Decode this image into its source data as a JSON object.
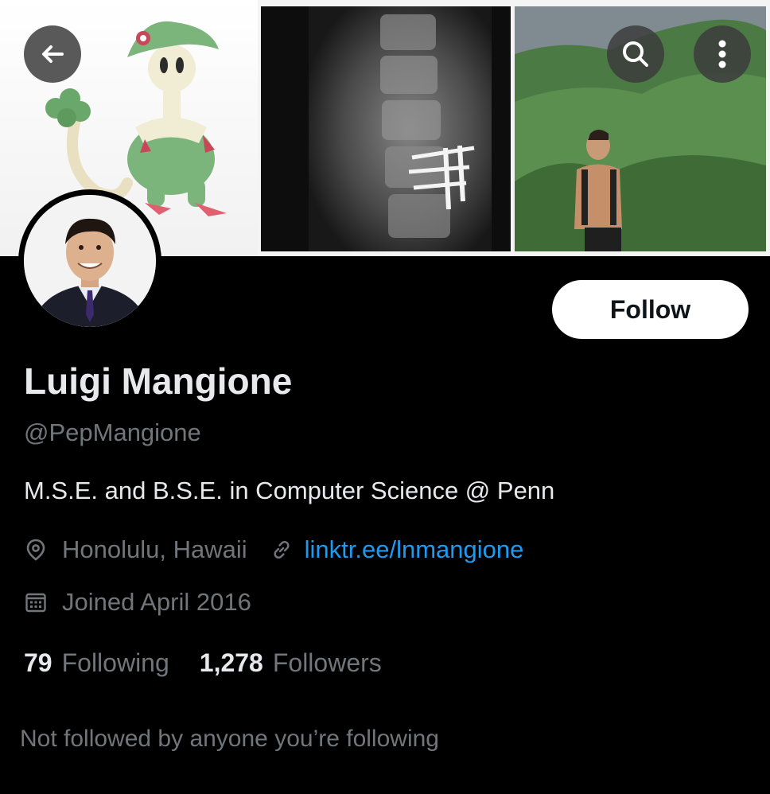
{
  "profile": {
    "display_name": "Luigi Mangione",
    "handle": "@PepMangione",
    "bio": "M.S.E. and B.S.E. in Computer Science @ Penn",
    "location": "Honolulu, Hawaii",
    "link": "linktr.ee/lnmangione",
    "joined": "Joined April 2016"
  },
  "stats": {
    "following_count": "79",
    "following_label": "Following",
    "followers_count": "1,278",
    "followers_label": "Followers"
  },
  "actions": {
    "follow_label": "Follow"
  },
  "footer": {
    "mutuals_note": "Not followed by anyone you’re following"
  },
  "header": {
    "images": [
      "pokemon-illustration",
      "spine-xray",
      "hiker-photo"
    ]
  },
  "colors": {
    "background": "#000000",
    "primary_text": "#e7e9ea",
    "secondary_text": "#71767b",
    "link": "#1d9bf0",
    "follow_button_bg": "#ffffff"
  }
}
